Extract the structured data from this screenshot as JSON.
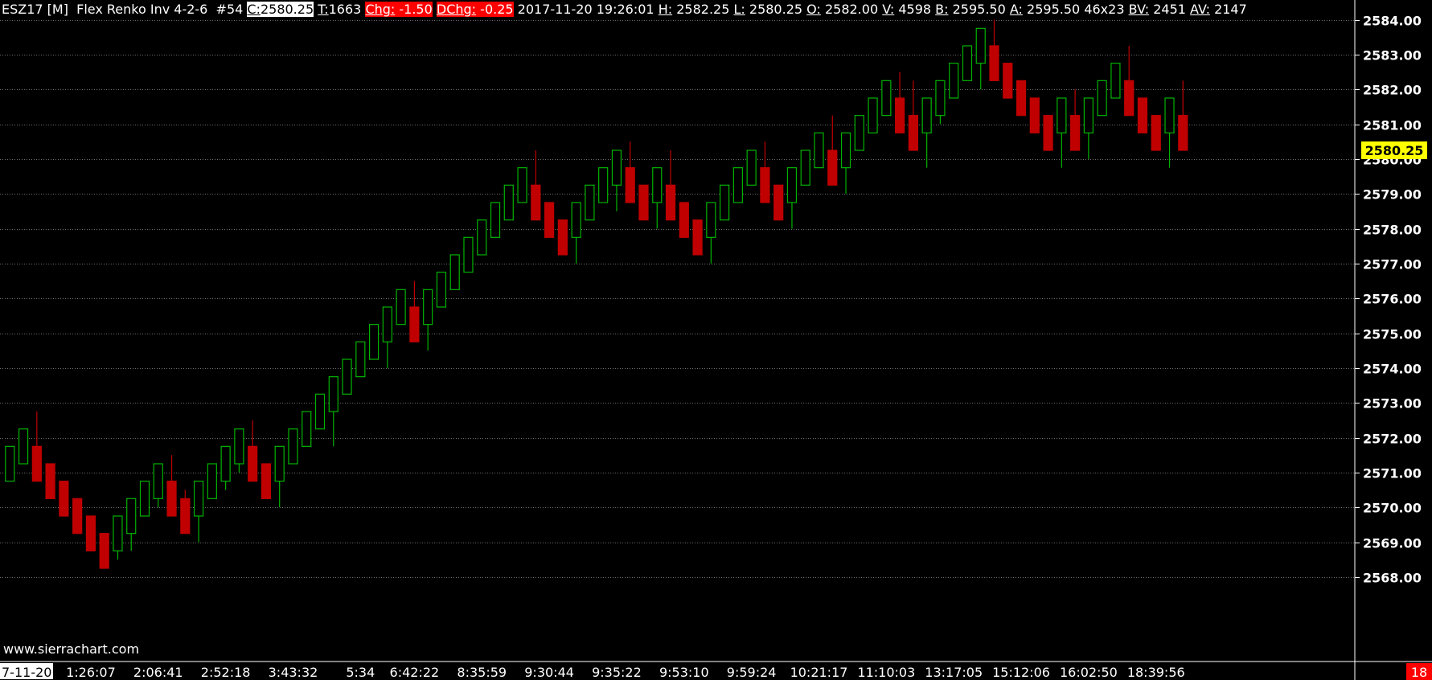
{
  "header": {
    "symbol": "ESZ17 [M]",
    "chart_type": "Flex Renko Inv 4-2-6",
    "chart_number": "#54",
    "close_label": "C:",
    "close_value": "2580.25",
    "trades_label": "T:",
    "trades_value": "1663",
    "chg_label": "Chg:",
    "chg_value": "-1.50",
    "dchg_label": "DChg:",
    "dchg_value": "-0.25",
    "datetime": "2017-11-20 19:26:01",
    "high_label": "H:",
    "high_value": "2582.25",
    "low_label": "L:",
    "low_value": "2580.25",
    "open_label": "O:",
    "open_value": "2582.00",
    "volume_label": "V:",
    "volume_value": "4598",
    "bid_label": "B:",
    "bid_value": "2595.50",
    "ask_label": "A:",
    "ask_value": "2595.50",
    "bidask_size": "46x23",
    "bv_label": "BV:",
    "bv_value": "2451",
    "av_label": "AV:",
    "av_value": "2147"
  },
  "watermark": "www.sierrachart.com",
  "first_date_label": "7-11-20",
  "corner_badge": "18",
  "colors": {
    "background": "#000000",
    "up": "#00b400",
    "down": "#c00000",
    "grid": "#707070",
    "price_marker": "#ffff00",
    "chg_bg": "#ff0000"
  },
  "chart_data": {
    "type": "candlestick",
    "grid": true,
    "current_price": 2580.25,
    "ylim": [
      2568.0,
      2584.5
    ],
    "y_ticks": [
      "2568.00",
      "2569.00",
      "2570.00",
      "2571.00",
      "2572.00",
      "2573.00",
      "2574.00",
      "2575.00",
      "2576.00",
      "2577.00",
      "2578.00",
      "2579.00",
      "2580.00",
      "2581.00",
      "2582.00",
      "2583.00",
      "2584.00"
    ],
    "x_tick_labels": [
      "1:26:07",
      "2:06:41",
      "2:52:18",
      "3:43:32",
      "5:34",
      "6:42:22",
      "8:35:59",
      "9:30:44",
      "9:35:22",
      "9:53:10",
      "9:59:24",
      "10:21:17",
      "11:10:03",
      "13:17:05",
      "15:12:06",
      "16:02:50",
      "18:39:56"
    ],
    "x_tick_bar_index": [
      6,
      11,
      16,
      21,
      26,
      30,
      35,
      40,
      45,
      50,
      55,
      60,
      65,
      70,
      75,
      80,
      85
    ],
    "bars": [
      {
        "o": 2570.75,
        "h": 2571.75,
        "l": 2570.75,
        "c": 2571.75
      },
      {
        "o": 2571.25,
        "h": 2572.25,
        "l": 2571.25,
        "c": 2572.25
      },
      {
        "o": 2571.75,
        "h": 2572.75,
        "l": 2570.75,
        "c": 2570.75
      },
      {
        "o": 2571.25,
        "h": 2571.25,
        "l": 2570.25,
        "c": 2570.25
      },
      {
        "o": 2570.75,
        "h": 2570.75,
        "l": 2569.75,
        "c": 2569.75
      },
      {
        "o": 2570.25,
        "h": 2570.25,
        "l": 2569.25,
        "c": 2569.25
      },
      {
        "o": 2569.75,
        "h": 2569.75,
        "l": 2568.75,
        "c": 2568.75
      },
      {
        "o": 2569.25,
        "h": 2569.25,
        "l": 2568.25,
        "c": 2568.25
      },
      {
        "o": 2568.75,
        "h": 2569.75,
        "l": 2568.5,
        "c": 2569.75
      },
      {
        "o": 2569.25,
        "h": 2570.25,
        "l": 2568.75,
        "c": 2570.25
      },
      {
        "o": 2569.75,
        "h": 2570.75,
        "l": 2569.75,
        "c": 2570.75
      },
      {
        "o": 2570.25,
        "h": 2571.25,
        "l": 2570.0,
        "c": 2571.25
      },
      {
        "o": 2570.75,
        "h": 2571.5,
        "l": 2569.75,
        "c": 2569.75
      },
      {
        "o": 2570.25,
        "h": 2570.5,
        "l": 2569.25,
        "c": 2569.25
      },
      {
        "o": 2569.75,
        "h": 2570.75,
        "l": 2569.0,
        "c": 2570.75
      },
      {
        "o": 2570.25,
        "h": 2571.25,
        "l": 2570.25,
        "c": 2571.25
      },
      {
        "o": 2570.75,
        "h": 2571.75,
        "l": 2570.5,
        "c": 2571.75
      },
      {
        "o": 2571.25,
        "h": 2572.25,
        "l": 2571.0,
        "c": 2572.25
      },
      {
        "o": 2571.75,
        "h": 2572.5,
        "l": 2570.75,
        "c": 2570.75
      },
      {
        "o": 2571.25,
        "h": 2571.25,
        "l": 2570.25,
        "c": 2570.25
      },
      {
        "o": 2570.75,
        "h": 2571.75,
        "l": 2570.0,
        "c": 2571.75
      },
      {
        "o": 2571.25,
        "h": 2572.25,
        "l": 2571.25,
        "c": 2572.25
      },
      {
        "o": 2571.75,
        "h": 2572.75,
        "l": 2571.75,
        "c": 2572.75
      },
      {
        "o": 2572.25,
        "h": 2573.25,
        "l": 2572.25,
        "c": 2573.25
      },
      {
        "o": 2572.75,
        "h": 2573.75,
        "l": 2571.75,
        "c": 2573.75
      },
      {
        "o": 2573.25,
        "h": 2574.25,
        "l": 2573.25,
        "c": 2574.25
      },
      {
        "o": 2573.75,
        "h": 2574.75,
        "l": 2573.75,
        "c": 2574.75
      },
      {
        "o": 2574.25,
        "h": 2575.25,
        "l": 2574.25,
        "c": 2575.25
      },
      {
        "o": 2574.75,
        "h": 2575.75,
        "l": 2574.0,
        "c": 2575.75
      },
      {
        "o": 2575.25,
        "h": 2576.25,
        "l": 2575.25,
        "c": 2576.25
      },
      {
        "o": 2575.75,
        "h": 2576.5,
        "l": 2574.75,
        "c": 2574.75
      },
      {
        "o": 2575.25,
        "h": 2576.25,
        "l": 2574.5,
        "c": 2576.25
      },
      {
        "o": 2575.75,
        "h": 2576.75,
        "l": 2575.75,
        "c": 2576.75
      },
      {
        "o": 2576.25,
        "h": 2577.25,
        "l": 2576.25,
        "c": 2577.25
      },
      {
        "o": 2576.75,
        "h": 2577.75,
        "l": 2576.75,
        "c": 2577.75
      },
      {
        "o": 2577.25,
        "h": 2578.25,
        "l": 2577.25,
        "c": 2578.25
      },
      {
        "o": 2577.75,
        "h": 2578.75,
        "l": 2577.75,
        "c": 2578.75
      },
      {
        "o": 2578.25,
        "h": 2579.25,
        "l": 2578.25,
        "c": 2579.25
      },
      {
        "o": 2578.75,
        "h": 2579.75,
        "l": 2578.75,
        "c": 2579.75
      },
      {
        "o": 2579.25,
        "h": 2580.25,
        "l": 2578.25,
        "c": 2578.25
      },
      {
        "o": 2578.75,
        "h": 2578.75,
        "l": 2577.75,
        "c": 2577.75
      },
      {
        "o": 2578.25,
        "h": 2578.25,
        "l": 2577.25,
        "c": 2577.25
      },
      {
        "o": 2577.75,
        "h": 2578.75,
        "l": 2577.0,
        "c": 2578.75
      },
      {
        "o": 2578.25,
        "h": 2579.25,
        "l": 2578.25,
        "c": 2579.25
      },
      {
        "o": 2578.75,
        "h": 2579.75,
        "l": 2578.75,
        "c": 2579.75
      },
      {
        "o": 2579.25,
        "h": 2580.25,
        "l": 2578.5,
        "c": 2580.25
      },
      {
        "o": 2579.75,
        "h": 2580.5,
        "l": 2578.75,
        "c": 2578.75
      },
      {
        "o": 2579.25,
        "h": 2579.25,
        "l": 2578.25,
        "c": 2578.25
      },
      {
        "o": 2578.75,
        "h": 2579.75,
        "l": 2578.0,
        "c": 2579.75
      },
      {
        "o": 2579.25,
        "h": 2580.25,
        "l": 2578.25,
        "c": 2578.25
      },
      {
        "o": 2578.75,
        "h": 2578.75,
        "l": 2577.75,
        "c": 2577.75
      },
      {
        "o": 2578.25,
        "h": 2578.25,
        "l": 2577.25,
        "c": 2577.25
      },
      {
        "o": 2577.75,
        "h": 2578.75,
        "l": 2577.0,
        "c": 2578.75
      },
      {
        "o": 2578.25,
        "h": 2579.25,
        "l": 2578.25,
        "c": 2579.25
      },
      {
        "o": 2578.75,
        "h": 2579.75,
        "l": 2578.75,
        "c": 2579.75
      },
      {
        "o": 2579.25,
        "h": 2580.25,
        "l": 2579.25,
        "c": 2580.25
      },
      {
        "o": 2579.75,
        "h": 2580.5,
        "l": 2578.75,
        "c": 2578.75
      },
      {
        "o": 2579.25,
        "h": 2579.25,
        "l": 2578.25,
        "c": 2578.25
      },
      {
        "o": 2578.75,
        "h": 2579.75,
        "l": 2578.0,
        "c": 2579.75
      },
      {
        "o": 2579.25,
        "h": 2580.25,
        "l": 2579.25,
        "c": 2580.25
      },
      {
        "o": 2579.75,
        "h": 2580.75,
        "l": 2579.75,
        "c": 2580.75
      },
      {
        "o": 2580.25,
        "h": 2581.25,
        "l": 2579.25,
        "c": 2579.25
      },
      {
        "o": 2579.75,
        "h": 2580.75,
        "l": 2579.0,
        "c": 2580.75
      },
      {
        "o": 2580.25,
        "h": 2581.25,
        "l": 2580.25,
        "c": 2581.25
      },
      {
        "o": 2580.75,
        "h": 2581.75,
        "l": 2580.75,
        "c": 2581.75
      },
      {
        "o": 2581.25,
        "h": 2582.25,
        "l": 2581.25,
        "c": 2582.25
      },
      {
        "o": 2581.75,
        "h": 2582.5,
        "l": 2580.75,
        "c": 2580.75
      },
      {
        "o": 2581.25,
        "h": 2582.25,
        "l": 2580.25,
        "c": 2580.25
      },
      {
        "o": 2580.75,
        "h": 2581.75,
        "l": 2579.75,
        "c": 2581.75
      },
      {
        "o": 2581.25,
        "h": 2582.25,
        "l": 2581.0,
        "c": 2582.25
      },
      {
        "o": 2581.75,
        "h": 2582.75,
        "l": 2581.75,
        "c": 2582.75
      },
      {
        "o": 2582.25,
        "h": 2583.25,
        "l": 2582.25,
        "c": 2583.25
      },
      {
        "o": 2582.75,
        "h": 2583.75,
        "l": 2582.0,
        "c": 2583.75
      },
      {
        "o": 2583.25,
        "h": 2584.0,
        "l": 2582.25,
        "c": 2582.25
      },
      {
        "o": 2582.75,
        "h": 2582.75,
        "l": 2581.75,
        "c": 2581.75
      },
      {
        "o": 2582.25,
        "h": 2582.25,
        "l": 2581.25,
        "c": 2581.25
      },
      {
        "o": 2581.75,
        "h": 2581.75,
        "l": 2580.75,
        "c": 2580.75
      },
      {
        "o": 2581.25,
        "h": 2581.25,
        "l": 2580.25,
        "c": 2580.25
      },
      {
        "o": 2580.75,
        "h": 2581.75,
        "l": 2579.75,
        "c": 2581.75
      },
      {
        "o": 2581.25,
        "h": 2582.0,
        "l": 2580.25,
        "c": 2580.25
      },
      {
        "o": 2580.75,
        "h": 2581.75,
        "l": 2580.0,
        "c": 2581.75
      },
      {
        "o": 2581.25,
        "h": 2582.25,
        "l": 2581.25,
        "c": 2582.25
      },
      {
        "o": 2581.75,
        "h": 2582.75,
        "l": 2581.75,
        "c": 2582.75
      },
      {
        "o": 2582.25,
        "h": 2583.25,
        "l": 2581.25,
        "c": 2581.25
      },
      {
        "o": 2581.75,
        "h": 2581.75,
        "l": 2580.75,
        "c": 2580.75
      },
      {
        "o": 2581.25,
        "h": 2581.25,
        "l": 2580.25,
        "c": 2580.25
      },
      {
        "o": 2580.75,
        "h": 2581.75,
        "l": 2579.75,
        "c": 2581.75
      },
      {
        "o": 2581.25,
        "h": 2582.25,
        "l": 2580.25,
        "c": 2580.25
      }
    ]
  }
}
